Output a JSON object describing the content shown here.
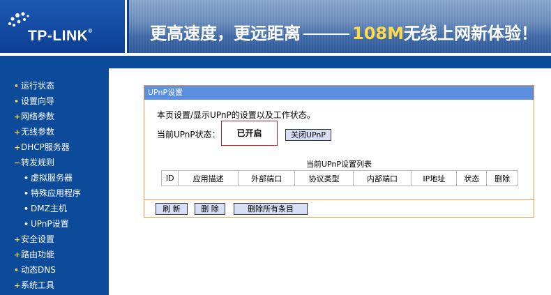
{
  "header": {
    "logo_text": "TP-LINK",
    "logo_reg": "®",
    "slogan_part1": "更高速度，更远距离",
    "slogan_num": "108M",
    "slogan_part2": "无线上网新体验！",
    "colors": {
      "header_blue": "#0a3f8a",
      "slogan_accent": "#ffd94a"
    }
  },
  "sidebar": {
    "items": [
      {
        "label": "运行状态",
        "bullet": "•"
      },
      {
        "label": "设置向导",
        "bullet": "•"
      },
      {
        "label": "网络参数",
        "bullet": "+"
      },
      {
        "label": "无线参数",
        "bullet": "+"
      },
      {
        "label": "DHCP服务器",
        "bullet": "+"
      },
      {
        "label": "转发规则",
        "bullet": "−"
      },
      {
        "label": "虚拟服务器",
        "bullet": "•"
      },
      {
        "label": "特殊应用程序",
        "bullet": "•"
      },
      {
        "label": "DMZ主机",
        "bullet": "•"
      },
      {
        "label": "UPnP设置",
        "bullet": "•"
      },
      {
        "label": "安全设置",
        "bullet": "+"
      },
      {
        "label": "路由功能",
        "bullet": "+"
      },
      {
        "label": "动态DNS",
        "bullet": "•"
      },
      {
        "label": "系统工具",
        "bullet": "+"
      }
    ]
  },
  "panel": {
    "title": "UPnP设置",
    "description": "本页设置/显示UPnP的设置以及工作状态。",
    "status_label": "当前UPnP状态：",
    "status_value": "已开启",
    "toggle_button": "关闭UPnP",
    "table_caption": "当前UPnP设置列表",
    "table_headers": [
      "ID",
      "应用描述",
      "外部端口",
      "协议类型",
      "内部端口",
      "IP地址",
      "状态",
      "删除"
    ],
    "refresh_button": "刷 新",
    "delete_button": "删 除",
    "delete_all_button": "删除所有条目"
  }
}
